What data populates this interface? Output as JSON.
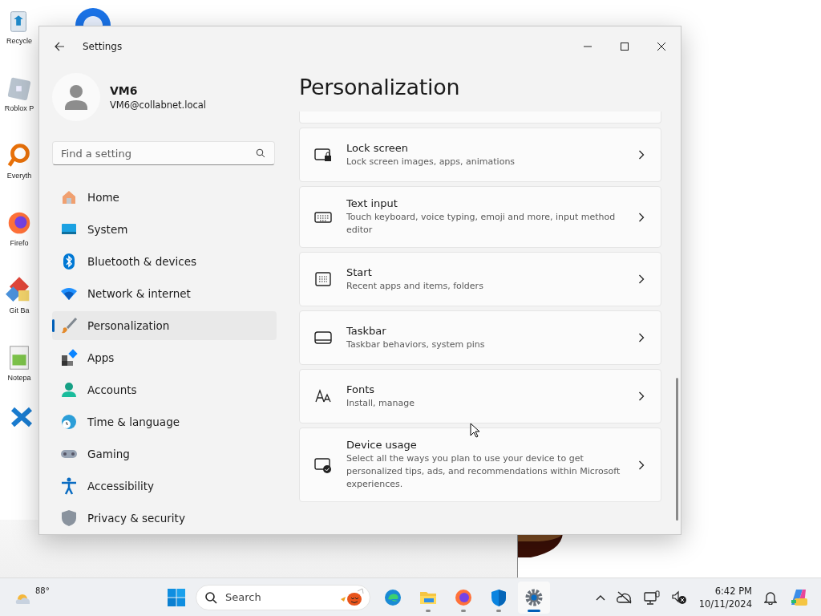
{
  "desktop": {
    "icons": [
      {
        "label": "Recycle"
      },
      {
        "label": "Roblox P"
      },
      {
        "label": "Everyth"
      },
      {
        "label": "Firefo"
      },
      {
        "label": "Git Ba"
      },
      {
        "label": "Notepa"
      }
    ]
  },
  "window": {
    "title": "Settings",
    "profile": {
      "name": "VM6",
      "email": "VM6@collabnet.local"
    },
    "search": {
      "placeholder": "Find a setting"
    },
    "nav": [
      {
        "label": "Home",
        "selected": false
      },
      {
        "label": "System",
        "selected": false
      },
      {
        "label": "Bluetooth & devices",
        "selected": false
      },
      {
        "label": "Network & internet",
        "selected": false
      },
      {
        "label": "Personalization",
        "selected": true
      },
      {
        "label": "Apps",
        "selected": false
      },
      {
        "label": "Accounts",
        "selected": false
      },
      {
        "label": "Time & language",
        "selected": false
      },
      {
        "label": "Gaming",
        "selected": false
      },
      {
        "label": "Accessibility",
        "selected": false
      },
      {
        "label": "Privacy & security",
        "selected": false
      }
    ],
    "page_title": "Personalization",
    "cards": [
      {
        "title": "Lock screen",
        "description": "Lock screen images, apps, animations"
      },
      {
        "title": "Text input",
        "description": "Touch keyboard, voice typing, emoji and more, input method editor"
      },
      {
        "title": "Start",
        "description": "Recent apps and items, folders"
      },
      {
        "title": "Taskbar",
        "description": "Taskbar behaviors, system pins"
      },
      {
        "title": "Fonts",
        "description": "Install, manage"
      },
      {
        "title": "Device usage",
        "description": "Select all the ways you plan to use your device to get personalized tips, ads, and recommendations within Microsoft experiences."
      }
    ]
  },
  "taskbar": {
    "weather": "88°",
    "search": {
      "placeholder": "Search"
    },
    "apps": [
      {
        "running": false,
        "selected": false
      },
      {
        "running": true,
        "selected": false
      },
      {
        "running": true,
        "selected": false
      },
      {
        "running": true,
        "selected": false
      },
      {
        "running": true,
        "selected": true
      }
    ],
    "time": "6:42 PM",
    "date": "10/11/2024"
  }
}
